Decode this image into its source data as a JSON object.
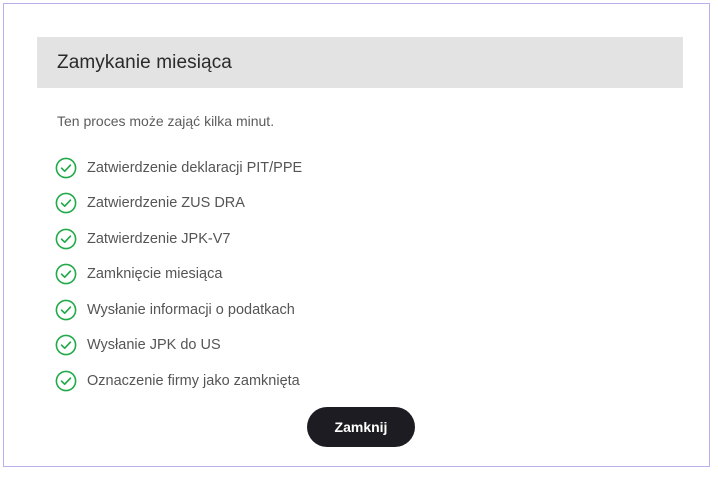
{
  "dialog": {
    "title": "Zamykanie miesiąca",
    "subtitle": "Ten proces może zająć kilka minut.",
    "steps": [
      {
        "label": "Zatwierdzenie deklaracji PIT/PPE",
        "status": "done",
        "icon": "check-circle-icon"
      },
      {
        "label": "Zatwierdzenie ZUS DRA",
        "status": "done",
        "icon": "check-circle-icon"
      },
      {
        "label": "Zatwierdzenie JPK-V7",
        "status": "done",
        "icon": "check-circle-icon"
      },
      {
        "label": "Zamknięcie miesiąca",
        "status": "done",
        "icon": "check-circle-icon"
      },
      {
        "label": "Wysłanie informacji o podatkach",
        "status": "done",
        "icon": "check-circle-icon"
      },
      {
        "label": "Wysłanie JPK do US",
        "status": "done",
        "icon": "check-circle-icon"
      },
      {
        "label": "Oznaczenie firmy jako zamknięta",
        "status": "done",
        "icon": "check-circle-icon"
      }
    ],
    "close_label": "Zamknij"
  },
  "colors": {
    "success": "#22a94a",
    "header_bg": "#e3e3e3",
    "button_bg": "#1c1c22",
    "frame_border": "#b7b0ee"
  }
}
